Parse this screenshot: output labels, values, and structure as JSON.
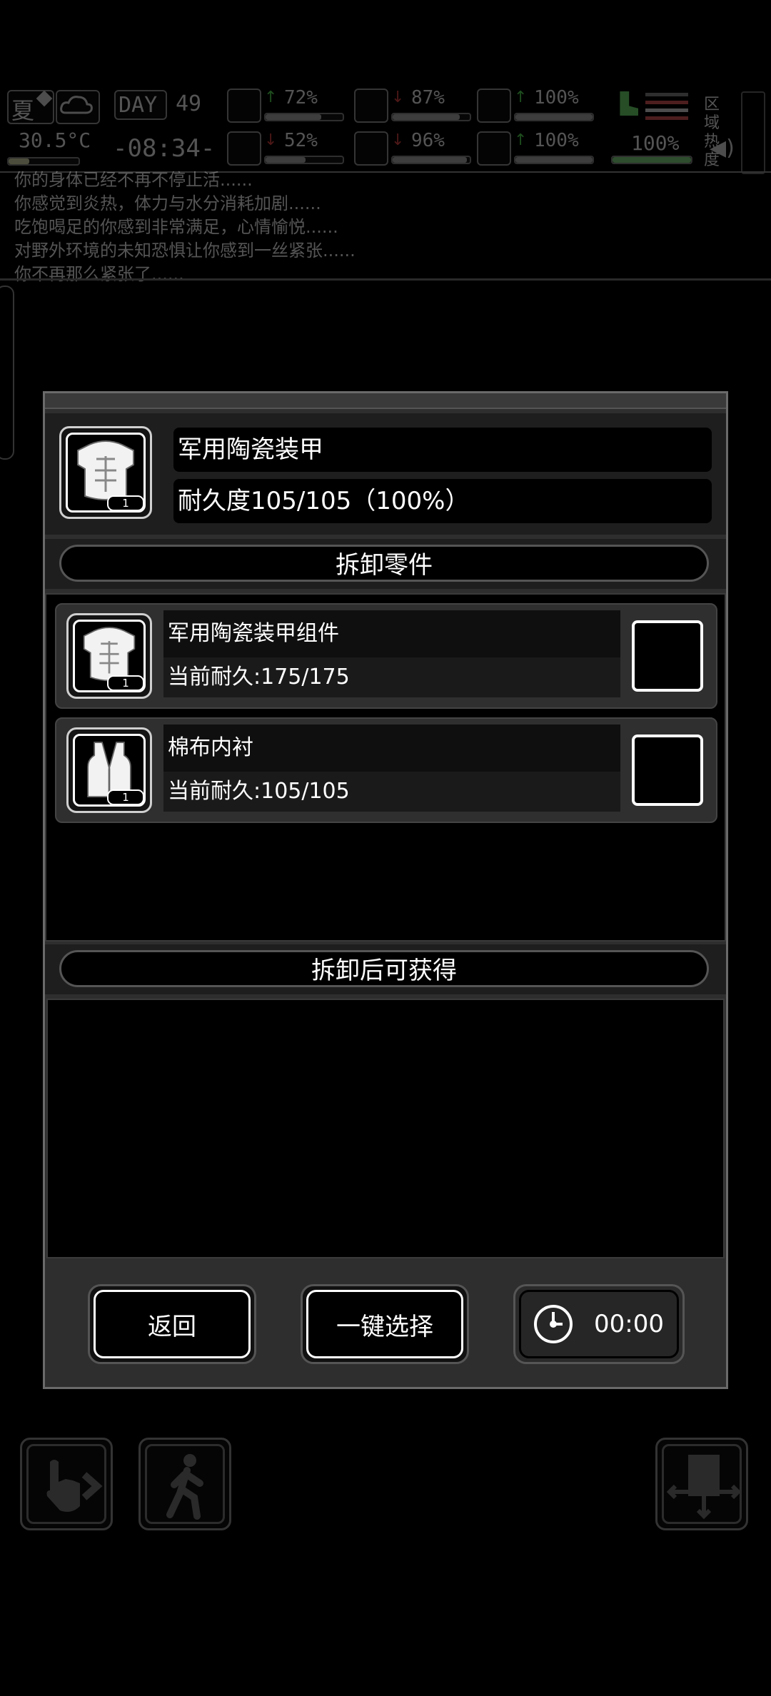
{
  "hud": {
    "season": "夏",
    "day_label": "DAY",
    "day_number": "49",
    "temperature": "30.5°C",
    "time": "-08:34-",
    "stats": [
      {
        "name": "health",
        "icon": "medkit-icon",
        "value": "72%",
        "trend": "up",
        "fill": 0.72
      },
      {
        "name": "hunger",
        "icon": "stomach-icon",
        "value": "87%",
        "trend": "down",
        "fill": 0.87
      },
      {
        "name": "stamina",
        "icon": "battery-icon",
        "value": "100%",
        "trend": "up",
        "fill": 1.0
      },
      {
        "name": "sanity",
        "icon": "brain-icon",
        "value": "52%",
        "trend": "down",
        "fill": 0.52
      },
      {
        "name": "thirst",
        "icon": "water-drop-icon",
        "value": "96%",
        "trend": "down",
        "fill": 0.96
      },
      {
        "name": "mood",
        "icon": "heart-icon",
        "value": "100%",
        "trend": "up",
        "fill": 1.0
      }
    ],
    "extra_value": "100%",
    "region_label": "区域热度"
  },
  "log": [
    "你的身体已经不再不停止活......",
    "你感觉到炎热，体力与水分消耗加剧......",
    "吃饱喝足的你感到非常满足，心情愉悦......",
    "对野外环境的未知恐惧让你感到一丝紧张......",
    "你不再那么紧张了......"
  ],
  "item": {
    "name": "军用陶瓷装甲",
    "durability": "耐久度105/105（100%）",
    "count": "1"
  },
  "parts_header": "拆卸零件",
  "parts": [
    {
      "name": "军用陶瓷装甲组件",
      "durability": "当前耐久:175/175",
      "count": "1",
      "icon": "armor-icon"
    },
    {
      "name": "棉布内衬",
      "durability": "当前耐久:105/105",
      "count": "1",
      "icon": "vest-icon"
    }
  ],
  "obtain_header": "拆卸后可获得",
  "buttons": {
    "back": "返回",
    "select_all": "一键选择",
    "timer": "00:00"
  }
}
